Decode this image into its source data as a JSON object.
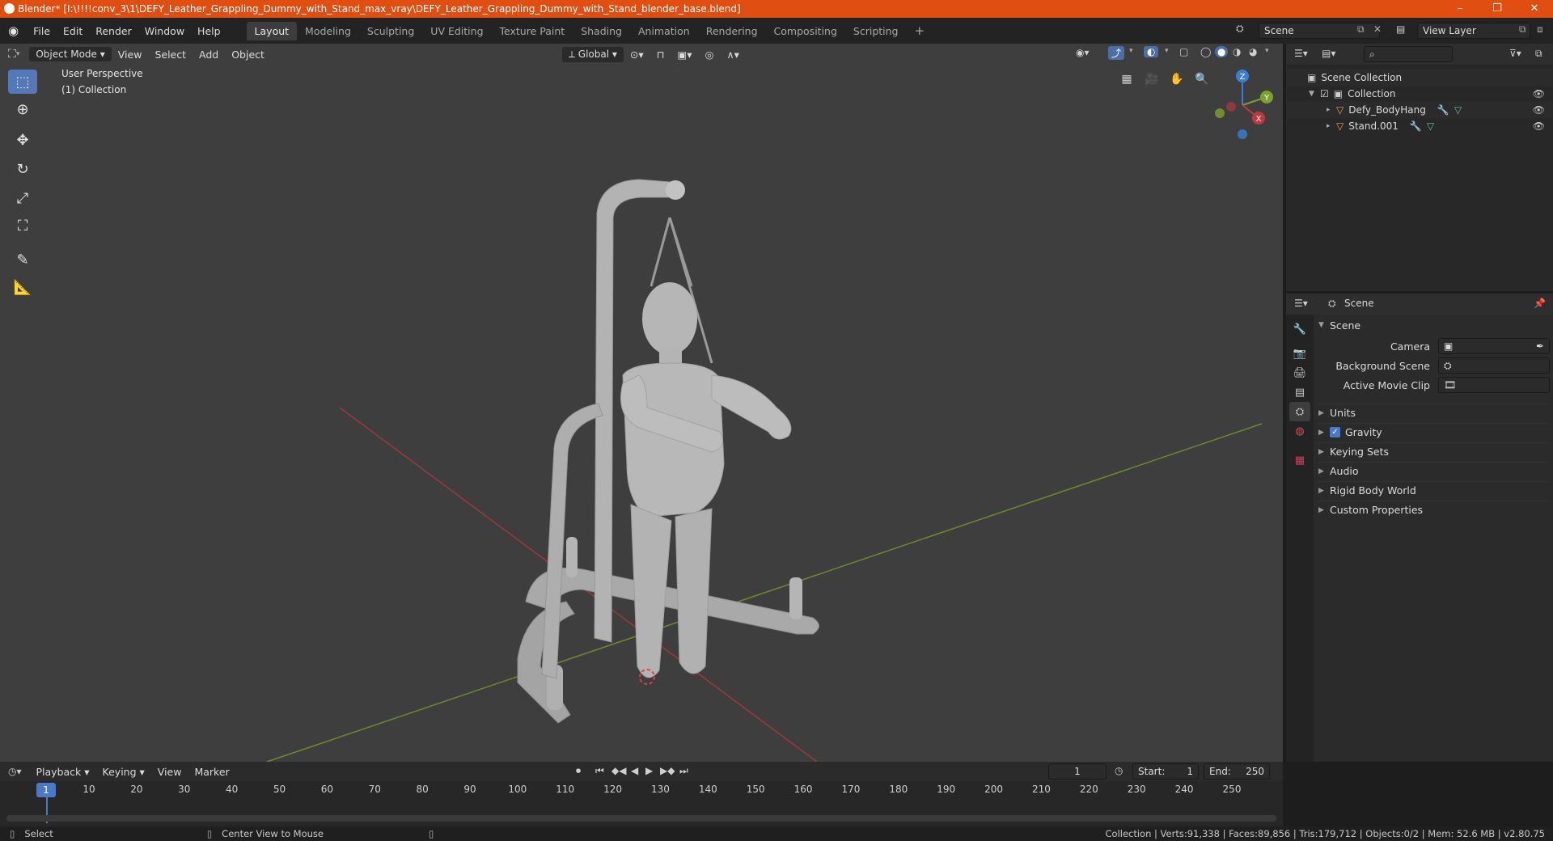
{
  "window": {
    "title": "Blender* [I:\\!!!!conv_3\\1\\DEFY_Leather_Grappling_Dummy_with_Stand_max_vray\\DEFY_Leather_Grappling_Dummy_with_Stand_blender_base.blend]",
    "minimize": "–",
    "maximize": "❐",
    "close": "✕"
  },
  "menu": [
    "File",
    "Edit",
    "Render",
    "Window",
    "Help"
  ],
  "workspaces": [
    "Layout",
    "Modeling",
    "Sculpting",
    "UV Editing",
    "Texture Paint",
    "Shading",
    "Animation",
    "Rendering",
    "Compositing",
    "Scripting"
  ],
  "active_workspace": "Layout",
  "scene_field": "Scene",
  "view_layer_field": "View Layer",
  "viewport": {
    "mode": "Object Mode",
    "menus": [
      "View",
      "Select",
      "Add",
      "Object"
    ],
    "orientation": "Global",
    "overlay_line1": "User Perspective",
    "overlay_line2": "(1) Collection",
    "gizmo": {
      "z": "Z",
      "y": "Y",
      "x": "X"
    }
  },
  "outliner": {
    "root": "Scene Collection",
    "collection": "Collection",
    "items": [
      "Defy_BodyHang",
      "Stand.001"
    ]
  },
  "properties": {
    "header": "Scene",
    "panel": "Scene",
    "camera_label": "Camera",
    "background_label": "Background Scene",
    "movieclip_label": "Active Movie Clip",
    "subpanels": [
      "Units",
      "Gravity",
      "Keying Sets",
      "Audio",
      "Rigid Body World",
      "Custom Properties"
    ]
  },
  "timeline": {
    "menus": [
      "Playback",
      "Keying",
      "View",
      "Marker"
    ],
    "current_frame": "1",
    "start_label": "Start:",
    "start": "1",
    "end_label": "End:",
    "end": "250",
    "ticks": [
      "1",
      "10",
      "20",
      "30",
      "40",
      "50",
      "60",
      "70",
      "80",
      "90",
      "100",
      "110",
      "120",
      "130",
      "140",
      "150",
      "160",
      "170",
      "180",
      "190",
      "200",
      "210",
      "220",
      "230",
      "240",
      "250"
    ]
  },
  "statusbar": {
    "select": "Select",
    "center": "Center View to Mouse",
    "stats": "Collection | Verts:91,338 | Faces:89,856 | Tris:179,712 | Objects:0/2 | Mem: 52.6 MB | v2.80.75"
  },
  "colors": {
    "titlebar": "#e04e12",
    "accent": "#5478b8",
    "x_axis": "#c0393f",
    "y_axis": "#7ea12d",
    "z_axis": "#3a7fd6"
  }
}
